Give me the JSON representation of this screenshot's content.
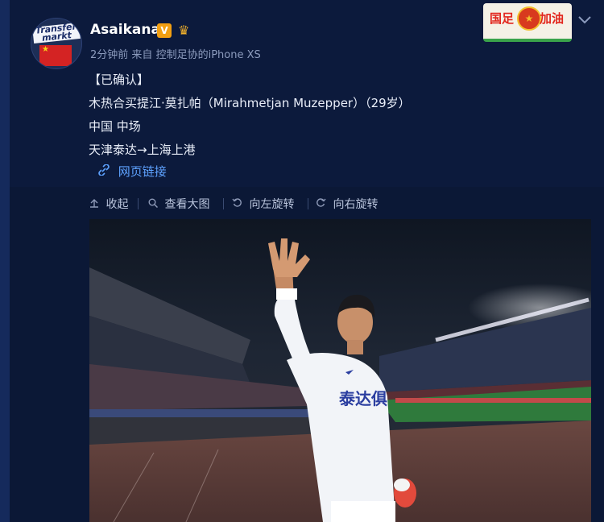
{
  "post": {
    "username": "Asaikana",
    "verified_badge": "V",
    "time": "2分钟前",
    "source_prefix": "来自",
    "source": "控制足协的iPhone XS",
    "avatar_logo_text": "Transfer markt",
    "lines": [
      "【已确认】",
      "木热合买提江·莫扎帕（Mirahmetjan Muzepper）（29岁）",
      "中国 中场",
      "天津泰达→上海上港"
    ],
    "link_label": "网页链接",
    "ad_left": "国足",
    "ad_right": "加油"
  },
  "toolbar": {
    "collapse": "收起",
    "view_large": "查看大图",
    "rotate_left": "向左旋转",
    "rotate_right": "向右旋转"
  },
  "photo": {
    "jersey_text": "泰达俱"
  },
  "icons": {
    "link": "link-icon",
    "collapse": "collapse-arrow-icon",
    "search": "search-icon",
    "rotate_left": "rotate-left-icon",
    "rotate_right": "rotate-right-icon",
    "chevron": "chevron-down-icon"
  },
  "colors": {
    "background": "#0b1836",
    "link": "#5ea2ff",
    "badge": "#f29f12"
  }
}
